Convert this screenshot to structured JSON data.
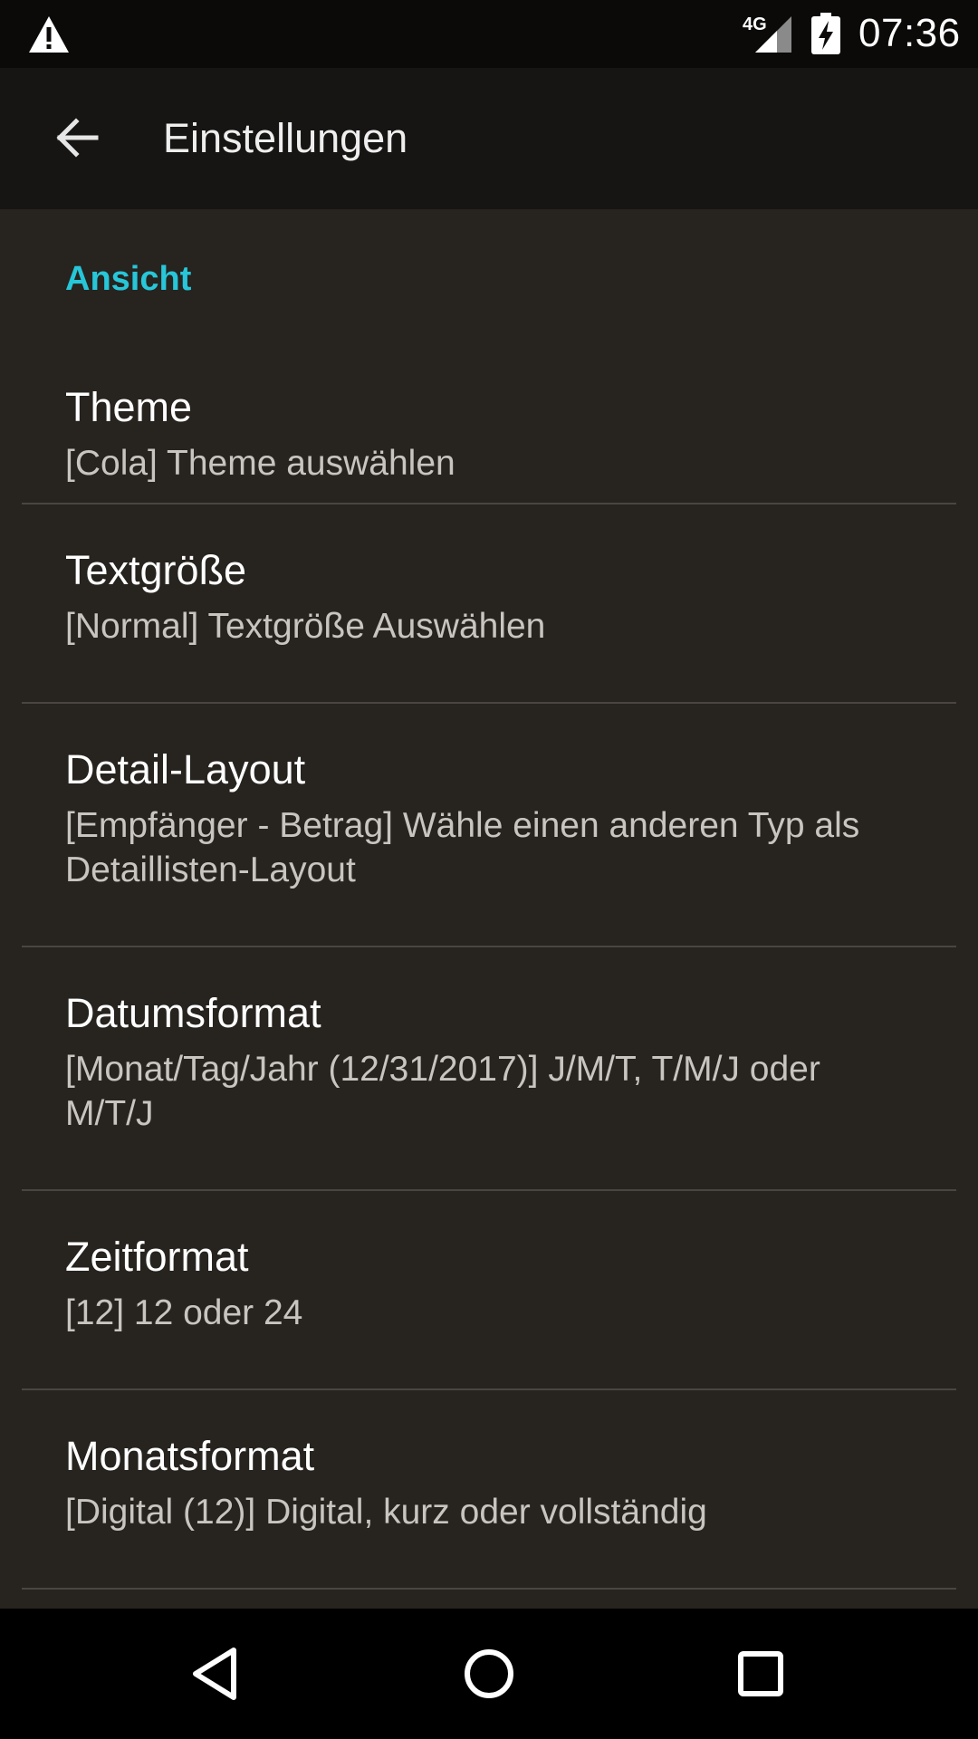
{
  "status_bar": {
    "warning_icon": "warning-triangle-icon",
    "network_label": "4G",
    "signal_icon": "cell-signal-icon",
    "battery_icon": "battery-charging-icon",
    "time": "07:36"
  },
  "app_bar": {
    "back_icon": "arrow-back-icon",
    "title": "Einstellungen"
  },
  "section": {
    "title": "Ansicht",
    "accent_color": "#27c6d8"
  },
  "preferences": [
    {
      "title": "Theme",
      "summary": "[Cola] Theme auswählen"
    },
    {
      "title": "Textgröße",
      "summary": "[Normal] Textgröße Auswählen"
    },
    {
      "title": "Detail-Layout",
      "summary": "[Empfänger - Betrag] Wähle einen anderen Typ als Detaillisten-Layout"
    },
    {
      "title": "Datumsformat",
      "summary": "[Monat/Tag/Jahr (12/31/2017)] J/M/T, T/M/J oder M/T/J"
    },
    {
      "title": "Zeitformat",
      "summary": "[12] 12 oder 24"
    },
    {
      "title": "Monatsformat",
      "summary": "[Digital (12)] Digital, kurz oder vollständig"
    }
  ],
  "nav_bar": {
    "back_icon": "nav-back-triangle-icon",
    "home_icon": "nav-home-circle-icon",
    "recents_icon": "nav-recents-square-icon"
  }
}
